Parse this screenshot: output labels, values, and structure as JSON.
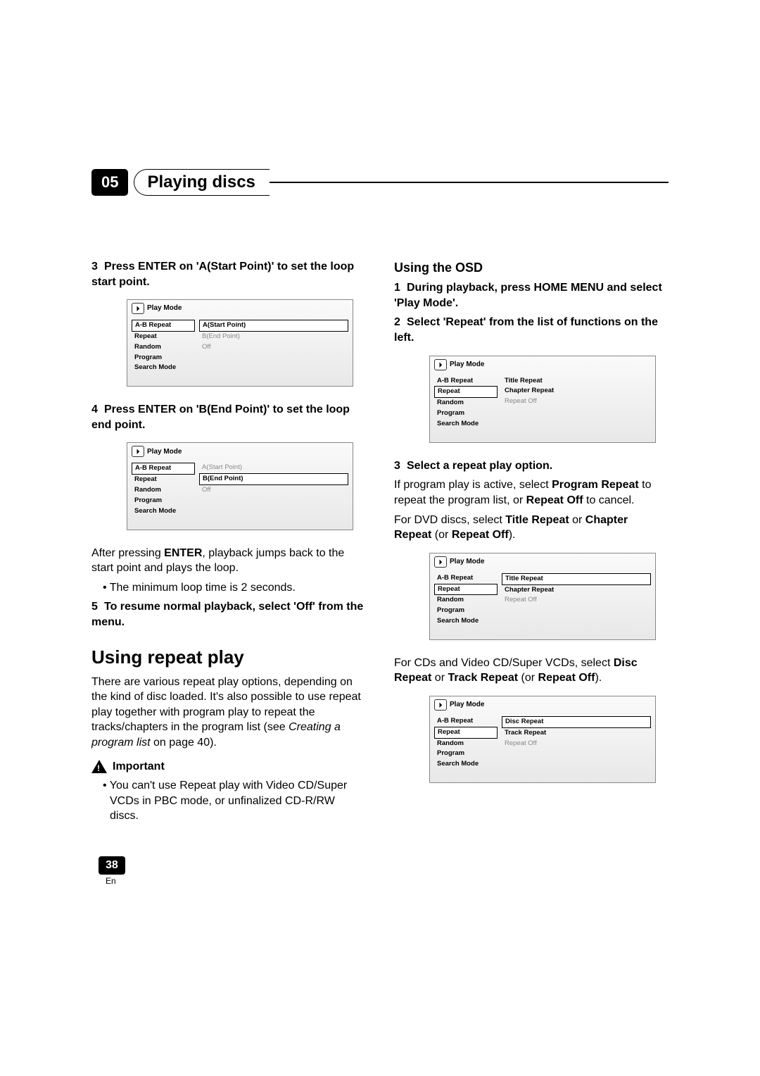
{
  "chapter": {
    "num": "05",
    "title": "Playing discs"
  },
  "left": {
    "step3": {
      "num": "3",
      "text_a": "Press ENTER on 'A(Start Point)' to set the loop start point."
    },
    "osd1": {
      "title": "Play Mode",
      "left": [
        "A-B Repeat",
        "Repeat",
        "Random",
        "Program",
        "Search Mode"
      ],
      "left_selected": 0,
      "right": [
        {
          "t": "A(Start Point)",
          "sel": true,
          "grey": false
        },
        {
          "t": "B(End Point)",
          "sel": false,
          "grey": true
        },
        {
          "t": "Off",
          "sel": false,
          "grey": true
        }
      ]
    },
    "step4": {
      "num": "4",
      "text_a": "Press ENTER on 'B(End Point)' to set the loop end point."
    },
    "osd2": {
      "title": "Play Mode",
      "left": [
        "A-B Repeat",
        "Repeat",
        "Random",
        "Program",
        "Search Mode"
      ],
      "left_selected": 0,
      "right": [
        {
          "t": "A(Start Point)",
          "sel": false,
          "grey": true
        },
        {
          "t": "B(End Point)",
          "sel": true,
          "grey": false
        },
        {
          "t": "Off",
          "sel": false,
          "grey": true
        }
      ]
    },
    "after_a": "After pressing ",
    "after_b": "ENTER",
    "after_c": ", playback jumps back to the start point and plays the loop.",
    "bullet1": "• The minimum loop time is 2 seconds.",
    "step5": {
      "num": "5",
      "text_a": "To resume normal playback, select 'Off' from the menu."
    },
    "h2": "Using repeat play",
    "para1_a": "There are various repeat play options, depending on the kind of disc loaded. It's also possible to use repeat play together with program play to repeat the tracks/chapters in the program list (see ",
    "para1_b": "Creating a program list",
    "para1_c": " on page 40).",
    "important": "Important",
    "imp_bullet": "• You can't use Repeat play with Video CD/Super VCDs in PBC mode, or unfinalized CD-R/RW discs."
  },
  "right": {
    "h3": "Using the OSD",
    "step1": {
      "num": "1",
      "text_a": "During playback, press HOME MENU and select 'Play Mode'."
    },
    "step2": {
      "num": "2",
      "text_a": "Select 'Repeat' from the list of functions on the left."
    },
    "osd3": {
      "title": "Play Mode",
      "left": [
        "A-B Repeat",
        "Repeat",
        "Random",
        "Program",
        "Search Mode"
      ],
      "left_selected": 1,
      "right": [
        {
          "t": "Title Repeat",
          "sel": false,
          "grey": false
        },
        {
          "t": "Chapter Repeat",
          "sel": false,
          "grey": false
        },
        {
          "t": "Repeat Off",
          "sel": false,
          "grey": true
        }
      ]
    },
    "step3": {
      "num": "3",
      "text_a": "Select a repeat play option."
    },
    "p3a": "If program play is active, select ",
    "p3b": "Program Repeat",
    "p3c": " to repeat the program list, or ",
    "p3d": "Repeat Off",
    "p3e": " to cancel.",
    "p4a": "For DVD discs, select ",
    "p4b": "Title Repeat",
    "p4c": " or ",
    "p4d": "Chapter Repeat",
    "p4e": " (or ",
    "p4f": "Repeat Off",
    "p4g": ").",
    "osd4": {
      "title": "Play Mode",
      "left": [
        "A-B Repeat",
        "Repeat",
        "Random",
        "Program",
        "Search Mode"
      ],
      "left_selected": 1,
      "right": [
        {
          "t": "Title Repeat",
          "sel": true,
          "grey": false
        },
        {
          "t": "Chapter Repeat",
          "sel": false,
          "grey": false
        },
        {
          "t": "Repeat Off",
          "sel": false,
          "grey": true
        }
      ]
    },
    "p5a": "For CDs and Video CD/Super VCDs, select ",
    "p5b": "Disc Repeat",
    "p5c": " or ",
    "p5d": "Track Repeat",
    "p5e": " (or ",
    "p5f": "Repeat Off",
    "p5g": ").",
    "osd5": {
      "title": "Play Mode",
      "left": [
        "A-B Repeat",
        "Repeat",
        "Random",
        "Program",
        "Search Mode"
      ],
      "left_selected": 1,
      "right": [
        {
          "t": "Disc Repeat",
          "sel": true,
          "grey": false
        },
        {
          "t": "Track Repeat",
          "sel": false,
          "grey": false
        },
        {
          "t": "Repeat Off",
          "sel": false,
          "grey": true
        }
      ]
    }
  },
  "footer": {
    "page": "38",
    "lang": "En"
  },
  "icons": {
    "playmode": "⏵"
  }
}
